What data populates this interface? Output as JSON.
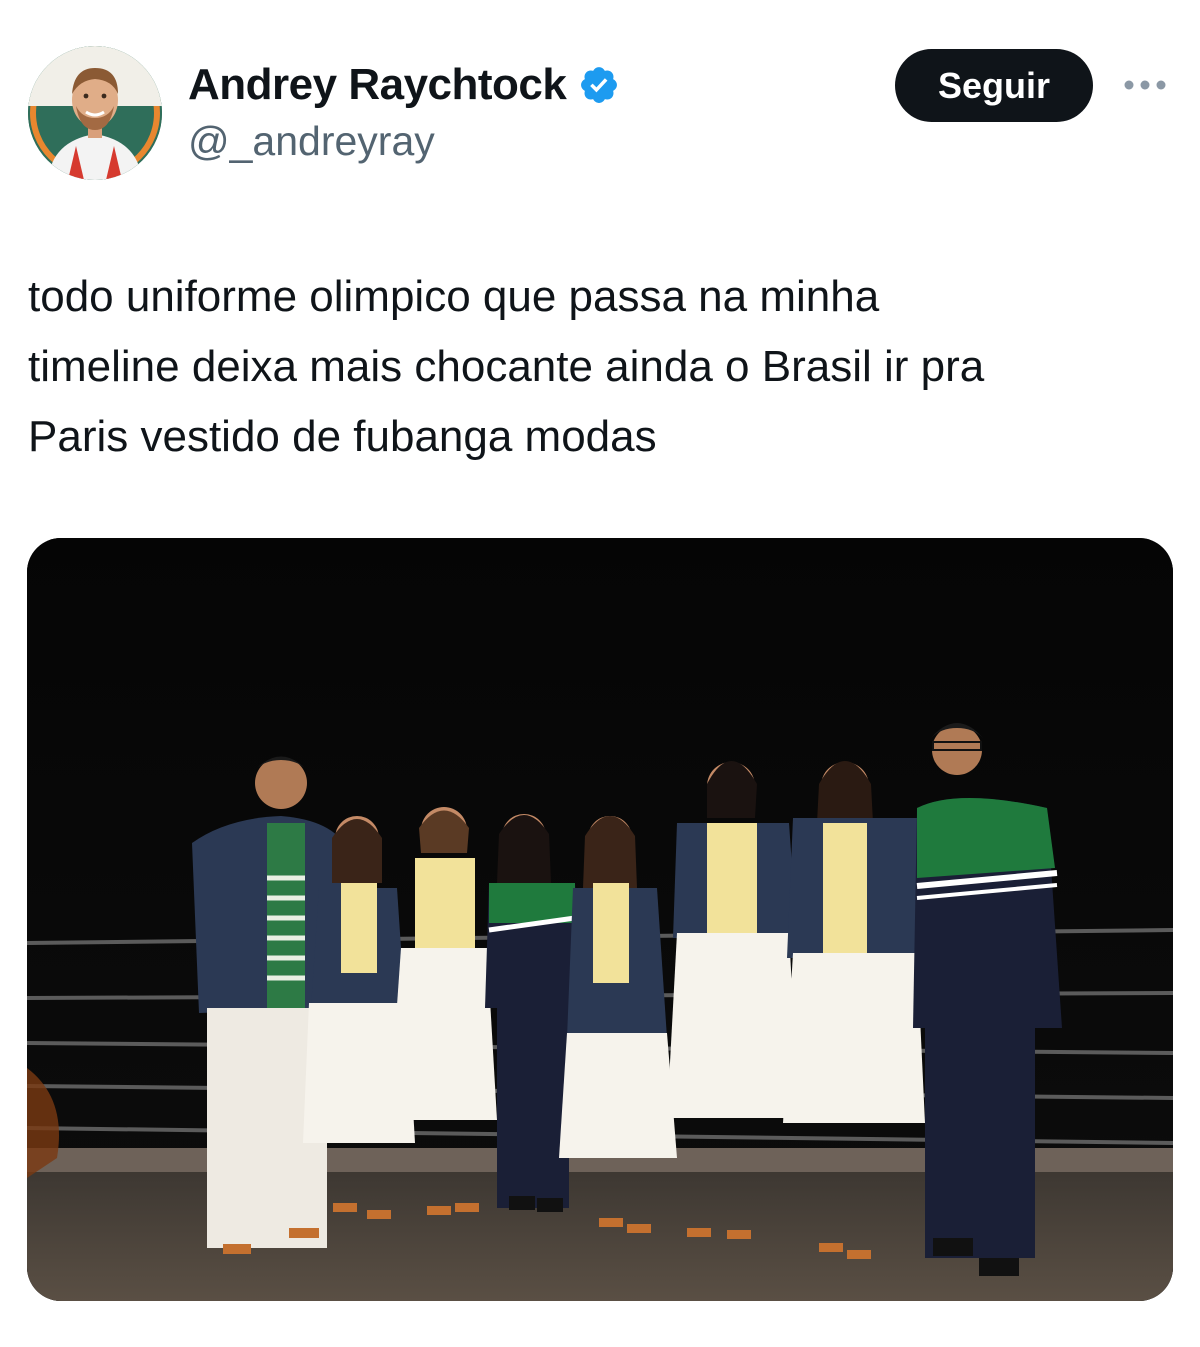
{
  "tweet": {
    "author": {
      "display_name": "Andrey Raychtock",
      "handle": "@_andreyray",
      "verified_icon": "verified-badge-icon",
      "avatar_icon": "avatar"
    },
    "follow_label": "Seguir",
    "more_icon": "more-options-icon",
    "text": "todo uniforme olimpico que passa na minha\ntimeline deixa mais chocante ainda o Brasil ir pra\nParis vestido de fubanga modas"
  },
  "colors": {
    "text_primary": "#0f1419",
    "text_secondary": "#536471",
    "verified_blue": "#1d9bf0",
    "button_bg": "#0f1419",
    "uniform_green": "#1f7a3d",
    "uniform_navy": "#1a1f36",
    "denim": "#2b3954",
    "shirt_yellow": "#f2e29a"
  }
}
